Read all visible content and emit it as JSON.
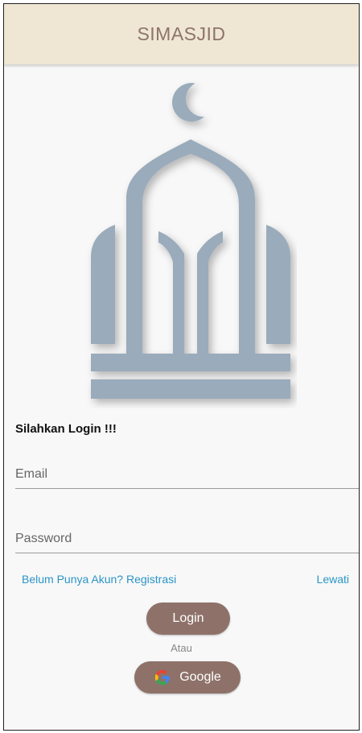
{
  "app_bar": {
    "title": "SIMASJID"
  },
  "form": {
    "heading": "Silahkan Login !!!",
    "email_placeholder": "Email",
    "password_placeholder": "Password"
  },
  "links": {
    "register": "Belum Punya Akun? Registrasi",
    "skip": "Lewati"
  },
  "buttons": {
    "login": "Login",
    "or": "Atau",
    "google": "Google"
  },
  "icons": {
    "logo": "mosque-icon",
    "google": "google-icon"
  },
  "colors": {
    "app_bar_bg": "#efe7d4",
    "title_text": "#8e736a",
    "button_bg": "#8e7269",
    "link_text": "#2a95c6",
    "logo": "#9aabbb"
  }
}
